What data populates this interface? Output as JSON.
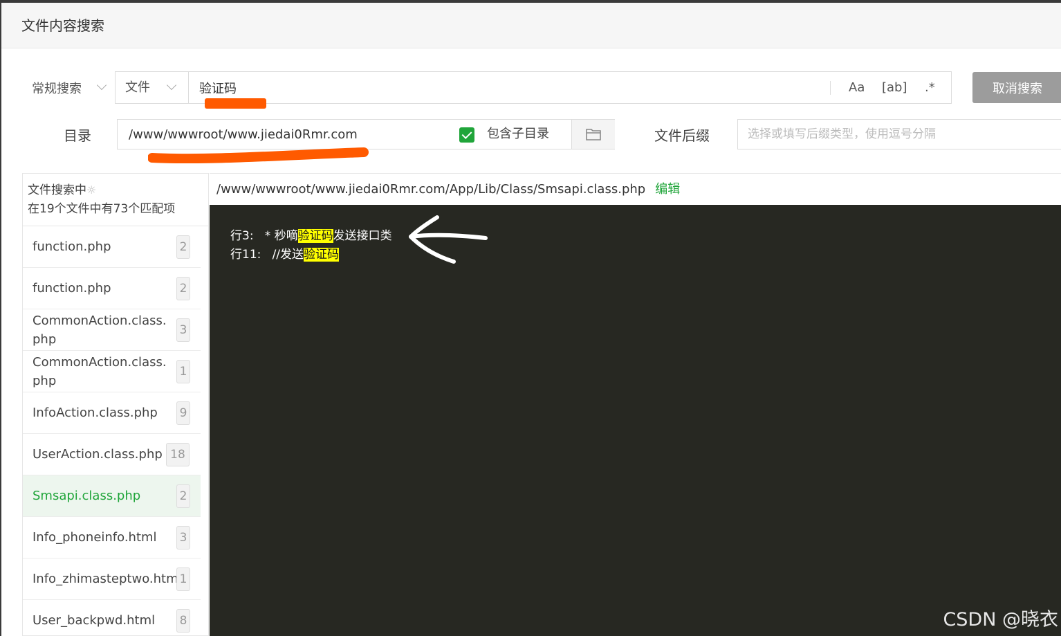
{
  "dialog": {
    "title": "文件内容搜索"
  },
  "search": {
    "mode": "常规搜索",
    "type": "文件",
    "query": "验证码",
    "opt_case": "Aa",
    "opt_word": "[ab]",
    "opt_regex": ".*",
    "cancel_label": "取消搜索"
  },
  "directory": {
    "label": "目录",
    "path": "/www/wwwroot/www.jiedai0Rmr.com",
    "include_sub_label": "包含子目录",
    "include_sub_checked": true
  },
  "suffix": {
    "label": "文件后缀",
    "placeholder": "选择或填写后缀类型，使用逗号分隔"
  },
  "status": {
    "line1": "文件搜索中",
    "spinner": "☼",
    "line2": "在19个文件中有73个匹配项"
  },
  "files": [
    {
      "name": "function.php",
      "count": "2"
    },
    {
      "name": "function.php",
      "count": "2"
    },
    {
      "name": "CommonAction.class.php",
      "count": "3"
    },
    {
      "name": "CommonAction.class.php",
      "count": "1"
    },
    {
      "name": "InfoAction.class.php",
      "count": "9"
    },
    {
      "name": "UserAction.class.php",
      "count": "18"
    },
    {
      "name": "Smsapi.class.php",
      "count": "2",
      "active": true
    },
    {
      "name": "Info_phoneinfo.html",
      "count": "3"
    },
    {
      "name": "Info_zhimasteptwo.html",
      "count": "1"
    },
    {
      "name": "User_backpwd.html",
      "count": "8"
    }
  ],
  "result": {
    "path": "/www/wwwroot/www.jiedai0Rmr.com/App/Lib/Class/Smsapi.class.php",
    "edit_label": "编辑",
    "lines": [
      {
        "prefix": "行3:   * 秒嘀",
        "match": "验证码",
        "suffix": "发送接口类"
      },
      {
        "prefix": "行11:   //发送",
        "match": "验证码",
        "suffix": ""
      }
    ]
  },
  "watermark": "CSDN @晓衣",
  "colors": {
    "accent": "#20a53a",
    "annotation": "#ff5a00",
    "code_bg": "#272822",
    "highlight": "#ffff00"
  }
}
